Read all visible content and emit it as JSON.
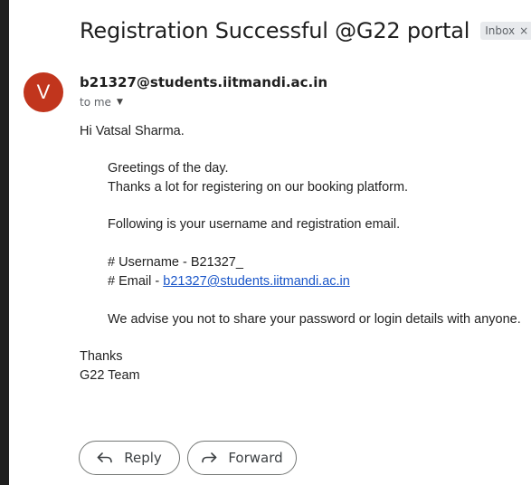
{
  "header": {
    "subject": "Registration Successful @G22 portal",
    "label": "Inbox",
    "label_close": "×"
  },
  "sender": {
    "avatar_letter": "V",
    "avatar_color": "#c1351d",
    "email": "b21327@students.iitmandi.ac.in",
    "to": "to me"
  },
  "body": {
    "greeting": "Hi Vatsal Sharma.",
    "line1": "Greetings of the day.",
    "line2": "Thanks a lot for registering on our booking platform.",
    "line3": "Following is your username and registration email.",
    "username_line": "# Username - B21327_",
    "email_prefix": "# Email - ",
    "email_link": "b21327@students.iitmandi.ac.in",
    "advice": "We advise you not to share your password or login details with anyone.",
    "signoff1": "Thanks",
    "signoff2": "G22 Team"
  },
  "actions": {
    "reply": "Reply",
    "forward": "Forward"
  },
  "icons": {
    "reply": "reply-arrow-icon",
    "forward": "forward-arrow-icon",
    "caret": "caret-down-icon",
    "close": "close-icon"
  },
  "colors": {
    "link": "#1a56c9",
    "chip_bg": "#e8eaed"
  }
}
